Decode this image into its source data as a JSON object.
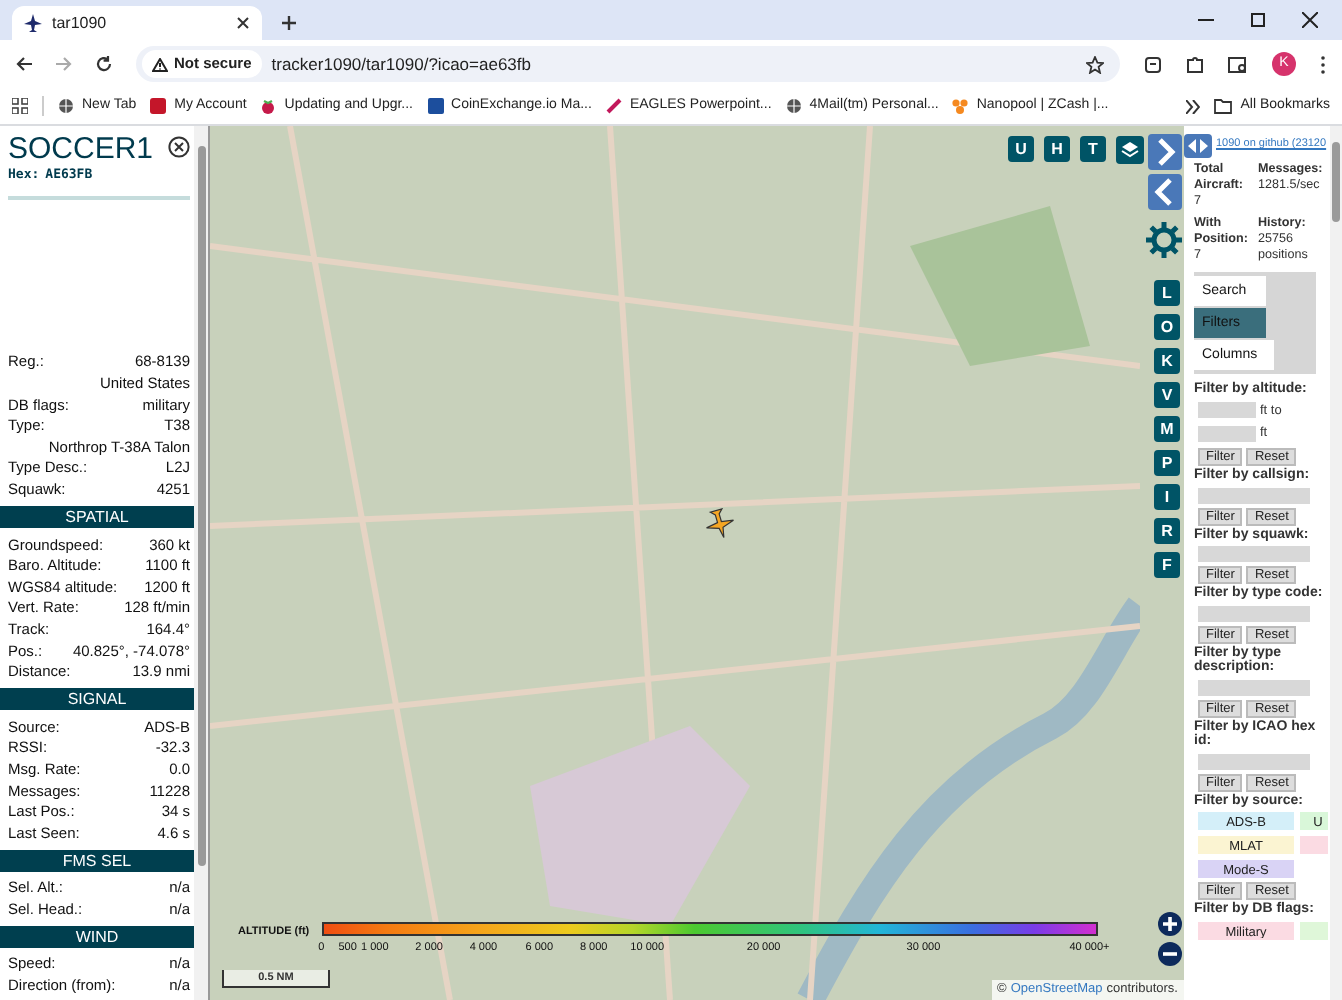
{
  "browser": {
    "tab_title": "tar1090",
    "not_secure": "Not secure",
    "url": "tracker1090/tar1090/?icao=ae63fb",
    "avatar": "K",
    "bookmarks": [
      {
        "label": "New Tab",
        "kind": "globe"
      },
      {
        "label": "My Account",
        "kind": "red"
      },
      {
        "label": "Updating and Upgr...",
        "kind": "berry"
      },
      {
        "label": "CoinExchange.io Ma...",
        "kind": "blue"
      },
      {
        "label": "EAGLES Powerpoint...",
        "kind": "pen"
      },
      {
        "label": "4Mail(tm) Personal...",
        "kind": "globe"
      },
      {
        "label": "Nanopool | ZCash |...",
        "kind": "orange"
      }
    ],
    "all_bookmarks": "All Bookmarks"
  },
  "aircraft": {
    "callsign": "SOCCER1",
    "hex_label": "Hex:",
    "hex": "AE63FB",
    "details": [
      {
        "kind": "row",
        "label": "Reg.:",
        "value": "68-8139"
      },
      {
        "kind": "row",
        "value": "United States"
      },
      {
        "kind": "row",
        "label": "DB flags:",
        "value": "military"
      },
      {
        "kind": "row",
        "label": "Type:",
        "value": "T38"
      },
      {
        "kind": "row",
        "value": "Northrop T-38A Talon"
      },
      {
        "kind": "row",
        "label": "Type Desc.:",
        "value": "L2J"
      },
      {
        "kind": "row",
        "label": "Squawk:",
        "value": "4251"
      },
      {
        "kind": "heading",
        "title": "SPATIAL"
      },
      {
        "kind": "row",
        "label": "Groundspeed:",
        "value": "360 kt"
      },
      {
        "kind": "row",
        "label": "Baro. Altitude:",
        "value": "1100 ft"
      },
      {
        "kind": "row",
        "label": "WGS84 altitude:",
        "value": "1200 ft"
      },
      {
        "kind": "row",
        "label": "Vert. Rate:",
        "value": "128 ft/min"
      },
      {
        "kind": "row",
        "label": "Track:",
        "value": "164.4°"
      },
      {
        "kind": "row",
        "label": "Pos.:",
        "value": "40.825°, -74.078°"
      },
      {
        "kind": "row",
        "label": "Distance:",
        "value": "13.9 nmi"
      },
      {
        "kind": "heading",
        "title": "SIGNAL"
      },
      {
        "kind": "row",
        "label": "Source:",
        "value": "ADS-B"
      },
      {
        "kind": "row",
        "label": "RSSI:",
        "value": "-32.3"
      },
      {
        "kind": "row",
        "label": "Msg. Rate:",
        "value": "0.0"
      },
      {
        "kind": "row",
        "label": "Messages:",
        "value": "11228"
      },
      {
        "kind": "row",
        "label": "Last Pos.:",
        "value": "34 s"
      },
      {
        "kind": "row",
        "label": "Last Seen:",
        "value": "4.6 s"
      },
      {
        "kind": "heading",
        "title": "FMS SEL"
      },
      {
        "kind": "row",
        "label": "Sel. Alt.:",
        "value": "n/a"
      },
      {
        "kind": "row",
        "label": "Sel. Head.:",
        "value": "n/a"
      },
      {
        "kind": "heading",
        "title": "WIND"
      },
      {
        "kind": "row",
        "label": "Speed:",
        "value": "n/a"
      },
      {
        "kind": "row",
        "label": "Direction (from):",
        "value": "n/a"
      }
    ]
  },
  "map": {
    "top_buttons": [
      "U",
      "H",
      "T"
    ],
    "side_buttons": [
      "L",
      "O",
      "K",
      "V",
      "M",
      "P",
      "I",
      "R",
      "F"
    ],
    "legend": {
      "title": "ALTITUDE (ft)",
      "ticks": [
        "0",
        "500",
        "1 000",
        "2 000",
        "4 000",
        "6 000",
        "8 000",
        "10 000",
        "20 000",
        "30 000",
        "40 000+"
      ]
    },
    "scale": "0.5 NM",
    "attribution": {
      "prefix": "©",
      "link": "OpenStreetMap",
      "suffix": "contributors."
    }
  },
  "sidebar": {
    "link": "1090 on github (23120",
    "stats": [
      {
        "label": "Total Aircraft:",
        "value": "7"
      },
      {
        "label": "Messages:",
        "value": "1281.5/sec"
      },
      {
        "label": "With Position:",
        "value": "7"
      },
      {
        "label": "History:",
        "value": "25756 positions"
      }
    ],
    "tabs": [
      {
        "label": "Search",
        "selected": false
      },
      {
        "label": "Filters",
        "selected": true
      },
      {
        "label": "Columns",
        "selected": false
      }
    ],
    "filters": [
      {
        "kind": "range",
        "label": "Filter by altitude:",
        "units": [
          "ft to",
          "ft"
        ],
        "buttons": [
          "Filter",
          "Reset"
        ]
      },
      {
        "kind": "text",
        "label": "Filter by callsign:",
        "buttons": [
          "Filter",
          "Reset"
        ]
      },
      {
        "kind": "text",
        "label": "Filter by squawk:",
        "buttons": [
          "Filter",
          "Reset"
        ]
      },
      {
        "kind": "text",
        "label": "Filter by type code:",
        "buttons": [
          "Filter",
          "Reset"
        ]
      },
      {
        "kind": "text",
        "label": "Filter by type description:",
        "buttons": [
          "Filter",
          "Reset"
        ]
      },
      {
        "kind": "text",
        "label": "Filter by ICAO hex id:",
        "buttons": [
          "Filter",
          "Reset"
        ]
      },
      {
        "kind": "chips",
        "label": "Filter by source:",
        "chips": [
          {
            "label": "ADS-B",
            "color": "#d4eff9"
          },
          {
            "label": "U",
            "color": "#d9f7d9"
          },
          {
            "label": "MLAT",
            "color": "#fbf4d2"
          },
          {
            "color": "#fbdbe3"
          },
          {
            "label": "Mode-S",
            "color": "#d9d3f5"
          }
        ],
        "buttons": [
          "Filter",
          "Reset"
        ]
      },
      {
        "kind": "chips",
        "label": "Filter by DB flags:",
        "chips": [
          {
            "label": "Military",
            "color": "#fbdbe3"
          },
          {
            "color": "#dff7d9"
          }
        ]
      }
    ]
  }
}
